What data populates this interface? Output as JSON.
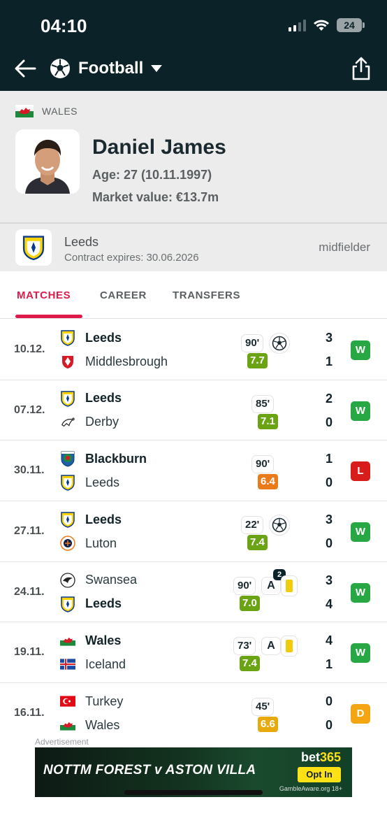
{
  "status_bar": {
    "time": "04:10",
    "battery": "24"
  },
  "nav": {
    "title": "Football"
  },
  "player": {
    "country": "WALES",
    "name": "Daniel James",
    "age": "Age: 27 (10.11.1997)",
    "market_value": "Market value: €13.7m"
  },
  "club": {
    "name": "Leeds",
    "contract": "Contract expires: 30.06.2026",
    "position": "midfielder"
  },
  "tabs": [
    {
      "label": "MATCHES",
      "active": true
    },
    {
      "label": "CAREER",
      "active": false
    },
    {
      "label": "TRANSFERS",
      "active": false
    }
  ],
  "matches": [
    {
      "date": "10.12.",
      "home": "Leeds",
      "home_crest": "leeds",
      "home_bold": true,
      "away": "Middlesbrough",
      "away_crest": "middlesbrough",
      "away_bold": false,
      "minutes": "90'",
      "goal": true,
      "assist": false,
      "assist_count": "",
      "yellow": false,
      "rating": "7.7",
      "rating_color": "#6aa313",
      "score_home": "3",
      "score_away": "1",
      "result": "W",
      "result_color": "#27a844"
    },
    {
      "date": "07.12.",
      "home": "Leeds",
      "home_crest": "leeds",
      "home_bold": true,
      "away": "Derby",
      "away_crest": "derby",
      "away_bold": false,
      "minutes": "85'",
      "goal": false,
      "assist": false,
      "assist_count": "",
      "yellow": false,
      "rating": "7.1",
      "rating_color": "#6aa313",
      "score_home": "2",
      "score_away": "0",
      "result": "W",
      "result_color": "#27a844"
    },
    {
      "date": "30.11.",
      "home": "Blackburn",
      "home_crest": "blackburn",
      "home_bold": true,
      "away": "Leeds",
      "away_crest": "leeds",
      "away_bold": false,
      "minutes": "90'",
      "goal": false,
      "assist": false,
      "assist_count": "",
      "yellow": false,
      "rating": "6.4",
      "rating_color": "#ea7a1a",
      "score_home": "1",
      "score_away": "0",
      "result": "L",
      "result_color": "#d81c1c"
    },
    {
      "date": "27.11.",
      "home": "Leeds",
      "home_crest": "leeds",
      "home_bold": true,
      "away": "Luton",
      "away_crest": "luton",
      "away_bold": false,
      "minutes": "22'",
      "goal": true,
      "assist": false,
      "assist_count": "",
      "yellow": false,
      "rating": "7.4",
      "rating_color": "#6aa313",
      "score_home": "3",
      "score_away": "0",
      "result": "W",
      "result_color": "#27a844"
    },
    {
      "date": "24.11.",
      "home": "Swansea",
      "home_crest": "swansea",
      "home_bold": false,
      "away": "Leeds",
      "away_crest": "leeds",
      "away_bold": true,
      "minutes": "90'",
      "goal": false,
      "assist": true,
      "assist_count": "2",
      "yellow": true,
      "rating": "7.0",
      "rating_color": "#6aa313",
      "score_home": "3",
      "score_away": "4",
      "result": "W",
      "result_color": "#27a844"
    },
    {
      "date": "19.11.",
      "home": "Wales",
      "home_crest": "wales",
      "home_bold": true,
      "away": "Iceland",
      "away_crest": "iceland",
      "away_bold": false,
      "minutes": "73'",
      "goal": false,
      "assist": true,
      "assist_count": "",
      "yellow": true,
      "rating": "7.4",
      "rating_color": "#6aa313",
      "score_home": "4",
      "score_away": "1",
      "result": "W",
      "result_color": "#27a844"
    },
    {
      "date": "16.11.",
      "home": "Turkey",
      "home_crest": "turkey",
      "home_bold": false,
      "away": "Wales",
      "away_crest": "wales",
      "away_bold": false,
      "minutes": "45'",
      "goal": false,
      "assist": false,
      "assist_count": "",
      "yellow": false,
      "rating": "6.6",
      "rating_color": "#e8a90c",
      "score_home": "0",
      "score_away": "0",
      "result": "D",
      "result_color": "#f3a512"
    }
  ],
  "ad": {
    "label": "Advertisement",
    "headline": "NOTTM FOREST v ASTON VILLA",
    "brand_main": "bet",
    "brand_accent": "365",
    "cta": "Opt In",
    "disclaimer": "GambleAware.org 18+"
  },
  "colors": {
    "header_bg": "#0c2229",
    "accent": "#de1a4a",
    "win": "#27a844",
    "loss": "#d81c1c",
    "draw": "#f3a512"
  }
}
